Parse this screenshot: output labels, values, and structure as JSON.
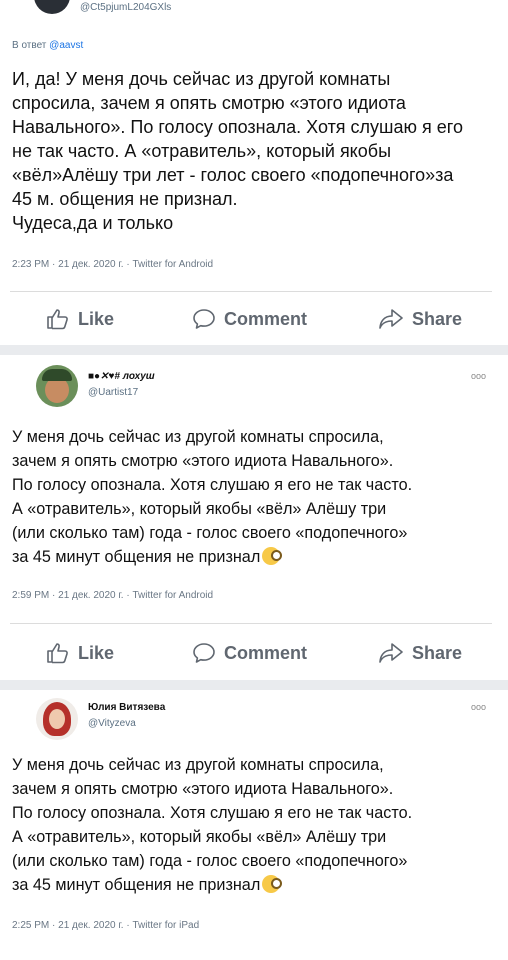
{
  "tweet1": {
    "handle": "@Ct5pjumL204GXls",
    "reply_to_label": "В ответ",
    "reply_to_user": "@aavst",
    "text": "И, да! У меня дочь сейчас из другой комнаты\nспросила, зачем я опять смотрю «этого идиота\nНавального». По голосу опознала. Хотя слушаю я его\nне так часто. А «отравитель», который якобы\n«вёл»Алёшу три  лет - голос своего «подопечного»за\n45 м. общения не признал.\nЧудеса,да и только",
    "meta": "2:23 PM · 21 дек. 2020 г. · Twitter for Android"
  },
  "actions": {
    "like": "Like",
    "comment": "Comment",
    "share": "Share"
  },
  "tweet2": {
    "name": "■●✕♥# лохуш",
    "handle": "@Uartist17",
    "more": "ooo",
    "text": "У меня дочь сейчас из другой комнаты спросила,\nзачем я опять смотрю «этого идиота Навального».\nПо голосу опознала. Хотя слушаю я его не так часто.\nА «отравитель», который якобы «вёл» Алёшу три\n(или сколько там) года - голос своего «подопечного»\nза 45 минут общения не признал",
    "meta": "2:59 PM · 21 дек. 2020 г. · Twitter for Android"
  },
  "tweet3": {
    "name": "Юлия Витязева",
    "handle": "@Vityzeva",
    "more": "ooo",
    "text": "У меня дочь сейчас из другой комнаты спросила,\nзачем я опять смотрю «этого идиота Навального».\nПо голосу опознала. Хотя слушаю я его не так часто.\nА «отравитель», который якобы «вёл» Алёшу три\n(или сколько там) года - голос своего «подопечного»\nза 45 минут общения не признал",
    "meta": "2:25 PM · 21 дек. 2020 г. · Twitter for iPad"
  },
  "icons": {
    "like": "thumbs-up-icon",
    "comment": "speech-bubble-icon",
    "share": "share-arrow-icon",
    "emoji": "face-with-monocle-emoji"
  }
}
